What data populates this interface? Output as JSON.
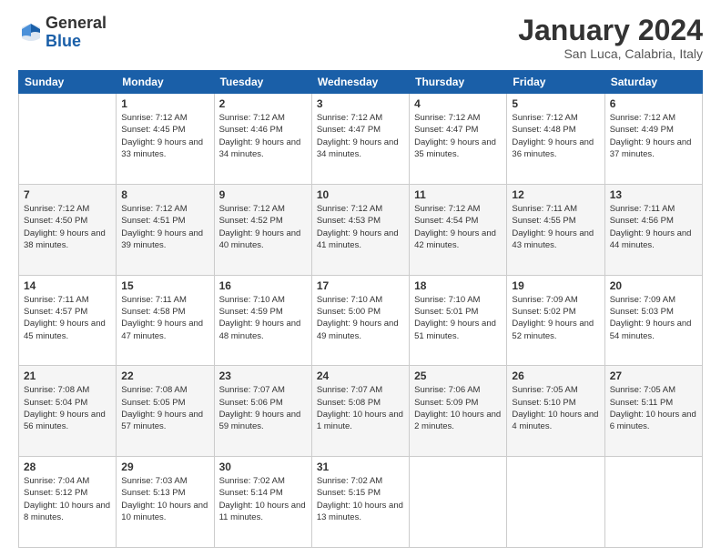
{
  "logo": {
    "general": "General",
    "blue": "Blue"
  },
  "title": "January 2024",
  "location": "San Luca, Calabria, Italy",
  "weekdays": [
    "Sunday",
    "Monday",
    "Tuesday",
    "Wednesday",
    "Thursday",
    "Friday",
    "Saturday"
  ],
  "weeks": [
    [
      {
        "day": "",
        "info": ""
      },
      {
        "day": "1",
        "info": "Sunrise: 7:12 AM\nSunset: 4:45 PM\nDaylight: 9 hours\nand 33 minutes."
      },
      {
        "day": "2",
        "info": "Sunrise: 7:12 AM\nSunset: 4:46 PM\nDaylight: 9 hours\nand 34 minutes."
      },
      {
        "day": "3",
        "info": "Sunrise: 7:12 AM\nSunset: 4:47 PM\nDaylight: 9 hours\nand 34 minutes."
      },
      {
        "day": "4",
        "info": "Sunrise: 7:12 AM\nSunset: 4:47 PM\nDaylight: 9 hours\nand 35 minutes."
      },
      {
        "day": "5",
        "info": "Sunrise: 7:12 AM\nSunset: 4:48 PM\nDaylight: 9 hours\nand 36 minutes."
      },
      {
        "day": "6",
        "info": "Sunrise: 7:12 AM\nSunset: 4:49 PM\nDaylight: 9 hours\nand 37 minutes."
      }
    ],
    [
      {
        "day": "7",
        "info": "Sunrise: 7:12 AM\nSunset: 4:50 PM\nDaylight: 9 hours\nand 38 minutes."
      },
      {
        "day": "8",
        "info": "Sunrise: 7:12 AM\nSunset: 4:51 PM\nDaylight: 9 hours\nand 39 minutes."
      },
      {
        "day": "9",
        "info": "Sunrise: 7:12 AM\nSunset: 4:52 PM\nDaylight: 9 hours\nand 40 minutes."
      },
      {
        "day": "10",
        "info": "Sunrise: 7:12 AM\nSunset: 4:53 PM\nDaylight: 9 hours\nand 41 minutes."
      },
      {
        "day": "11",
        "info": "Sunrise: 7:12 AM\nSunset: 4:54 PM\nDaylight: 9 hours\nand 42 minutes."
      },
      {
        "day": "12",
        "info": "Sunrise: 7:11 AM\nSunset: 4:55 PM\nDaylight: 9 hours\nand 43 minutes."
      },
      {
        "day": "13",
        "info": "Sunrise: 7:11 AM\nSunset: 4:56 PM\nDaylight: 9 hours\nand 44 minutes."
      }
    ],
    [
      {
        "day": "14",
        "info": "Sunrise: 7:11 AM\nSunset: 4:57 PM\nDaylight: 9 hours\nand 45 minutes."
      },
      {
        "day": "15",
        "info": "Sunrise: 7:11 AM\nSunset: 4:58 PM\nDaylight: 9 hours\nand 47 minutes."
      },
      {
        "day": "16",
        "info": "Sunrise: 7:10 AM\nSunset: 4:59 PM\nDaylight: 9 hours\nand 48 minutes."
      },
      {
        "day": "17",
        "info": "Sunrise: 7:10 AM\nSunset: 5:00 PM\nDaylight: 9 hours\nand 49 minutes."
      },
      {
        "day": "18",
        "info": "Sunrise: 7:10 AM\nSunset: 5:01 PM\nDaylight: 9 hours\nand 51 minutes."
      },
      {
        "day": "19",
        "info": "Sunrise: 7:09 AM\nSunset: 5:02 PM\nDaylight: 9 hours\nand 52 minutes."
      },
      {
        "day": "20",
        "info": "Sunrise: 7:09 AM\nSunset: 5:03 PM\nDaylight: 9 hours\nand 54 minutes."
      }
    ],
    [
      {
        "day": "21",
        "info": "Sunrise: 7:08 AM\nSunset: 5:04 PM\nDaylight: 9 hours\nand 56 minutes."
      },
      {
        "day": "22",
        "info": "Sunrise: 7:08 AM\nSunset: 5:05 PM\nDaylight: 9 hours\nand 57 minutes."
      },
      {
        "day": "23",
        "info": "Sunrise: 7:07 AM\nSunset: 5:06 PM\nDaylight: 9 hours\nand 59 minutes."
      },
      {
        "day": "24",
        "info": "Sunrise: 7:07 AM\nSunset: 5:08 PM\nDaylight: 10 hours\nand 1 minute."
      },
      {
        "day": "25",
        "info": "Sunrise: 7:06 AM\nSunset: 5:09 PM\nDaylight: 10 hours\nand 2 minutes."
      },
      {
        "day": "26",
        "info": "Sunrise: 7:05 AM\nSunset: 5:10 PM\nDaylight: 10 hours\nand 4 minutes."
      },
      {
        "day": "27",
        "info": "Sunrise: 7:05 AM\nSunset: 5:11 PM\nDaylight: 10 hours\nand 6 minutes."
      }
    ],
    [
      {
        "day": "28",
        "info": "Sunrise: 7:04 AM\nSunset: 5:12 PM\nDaylight: 10 hours\nand 8 minutes."
      },
      {
        "day": "29",
        "info": "Sunrise: 7:03 AM\nSunset: 5:13 PM\nDaylight: 10 hours\nand 10 minutes."
      },
      {
        "day": "30",
        "info": "Sunrise: 7:02 AM\nSunset: 5:14 PM\nDaylight: 10 hours\nand 11 minutes."
      },
      {
        "day": "31",
        "info": "Sunrise: 7:02 AM\nSunset: 5:15 PM\nDaylight: 10 hours\nand 13 minutes."
      },
      {
        "day": "",
        "info": ""
      },
      {
        "day": "",
        "info": ""
      },
      {
        "day": "",
        "info": ""
      }
    ]
  ]
}
